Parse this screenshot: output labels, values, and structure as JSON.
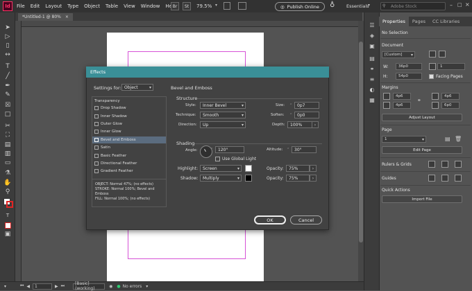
{
  "app": {
    "logo": "Id",
    "menu": [
      "File",
      "Edit",
      "Layout",
      "Type",
      "Object",
      "Table",
      "View",
      "Window",
      "Help"
    ],
    "br": "Br",
    "st": "St",
    "zoom": "79.5%",
    "publish": "Publish Online",
    "workspace": "Essentials",
    "search_placeholder": "Adobe Stock"
  },
  "document_tab": {
    "title": "*Untitled-1 @ 80%",
    "close": "×"
  },
  "status_bar": {
    "page": "1",
    "style": "[Basic] (working)",
    "errors": "No errors"
  },
  "properties": {
    "tabs": [
      "Properties",
      "Pages",
      "CC Libraries"
    ],
    "selection": "No Selection",
    "document": {
      "section_label": "Document",
      "preset": "[Custom]",
      "pages": "1",
      "width_label": "W:",
      "width": "36p0",
      "height_label": "H:",
      "height": "54p0",
      "facing_pages": "Facing Pages"
    },
    "margins": {
      "section_label": "Margins",
      "values": [
        "4p6",
        "4p6",
        "4p6",
        "6p0"
      ]
    },
    "adjust_layout": "Adjust Layout",
    "page": {
      "section_label": "Page",
      "value": "1",
      "edit_page": "Edit Page"
    },
    "rulers_grids": "Rulers & Grids",
    "guides": "Guides",
    "quick_actions": {
      "label": "Quick Actions",
      "import_file": "Import File"
    }
  },
  "dialog": {
    "title": "Effects",
    "settings_for_label": "Settings for:",
    "settings_for_value": "Object",
    "effect_title": "Bevel and Emboss",
    "list_header": "Transparency",
    "effects": [
      "Drop Shadow",
      "Inner Shadow",
      "Outer Glow",
      "Inner Glow",
      "Bevel and Emboss",
      "Satin",
      "Basic Feather",
      "Directional Feather",
      "Gradient Feather"
    ],
    "summary": [
      "OBJECT: Normal 47%; (no effects)",
      "STROKE: Normal 100%; Bevel and",
      "Emboss",
      "FILL: Normal 100%; (no effects)"
    ],
    "structure": {
      "label": "Structure",
      "style_label": "Style:",
      "style": "Inner Bevel",
      "technique_label": "Technique:",
      "technique": "Smooth",
      "direction_label": "Direction:",
      "direction": "Up",
      "size_label": "Size:",
      "size": "0p7",
      "soften_label": "Soften:",
      "soften": "0p0",
      "depth_label": "Depth:",
      "depth": "100%"
    },
    "shading": {
      "label": "Shading",
      "angle_label": "Angle:",
      "angle": "120°",
      "altitude_label": "Altitude:",
      "altitude": "30°",
      "use_global_light": "Use Global Light",
      "highlight_label": "Highlight:",
      "highlight": "Screen",
      "shadow_label": "Shadow:",
      "shadow": "Multiply",
      "opacity_label": "Opacity:",
      "highlight_opacity": "75%",
      "shadow_opacity": "75%"
    },
    "ok": "OK",
    "cancel": "Cancel"
  },
  "colors": {
    "dialog_title_bar": "#3a8f97",
    "margin_guides": "#d651d6",
    "selection": "#5b6c7f",
    "logo": "#ff3366"
  }
}
